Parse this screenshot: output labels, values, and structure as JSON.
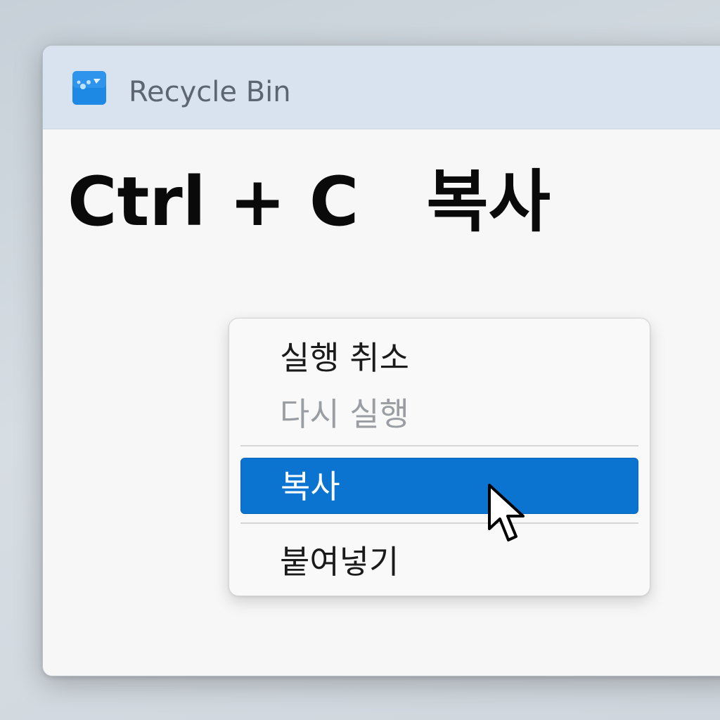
{
  "window": {
    "title": "Recycle Bin",
    "icon": "recycle-bin-icon"
  },
  "headline": {
    "shortcut": "Ctrl + C",
    "action": "복사"
  },
  "context_menu": {
    "items": [
      {
        "label": "실행 취소",
        "state": "enabled"
      },
      {
        "label": "다시 실행",
        "state": "disabled"
      },
      {
        "label": "복사",
        "state": "highlighted"
      },
      {
        "label": "붙여넣기",
        "state": "enabled"
      }
    ]
  },
  "cursor": {
    "icon": "arrow-pointer-icon"
  },
  "colors": {
    "titlebar": "#d9e3ef",
    "highlight": "#0b74d1",
    "icon_blue": "#1e88e5",
    "disabled_text": "#9a9ea3"
  }
}
